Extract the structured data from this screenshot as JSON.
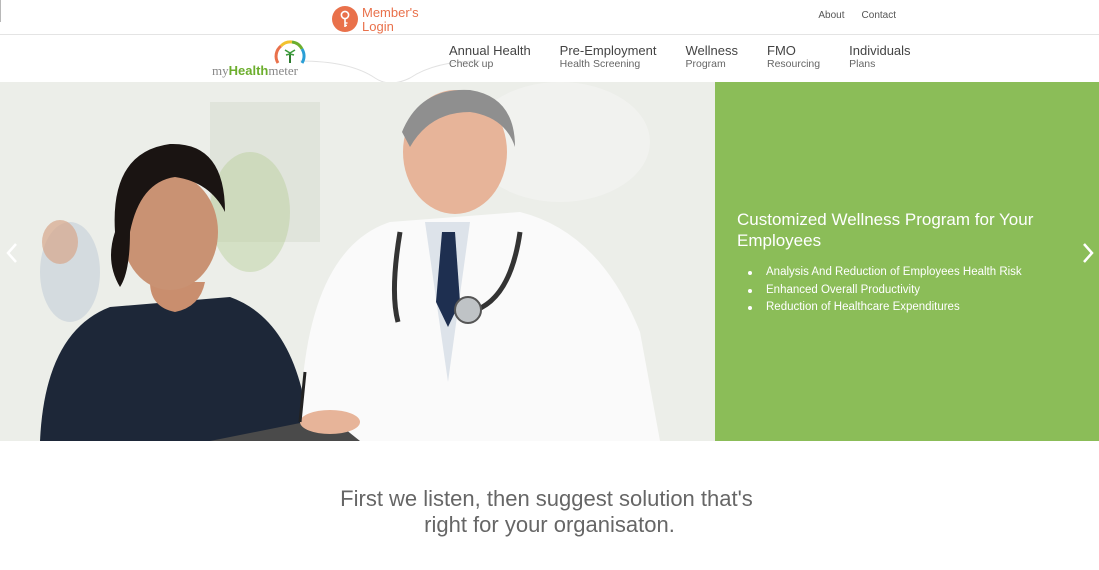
{
  "header": {
    "member_login": {
      "line1": "Member's",
      "line2": "Login"
    },
    "top_links": [
      {
        "label": "About"
      },
      {
        "label": "Contact"
      }
    ],
    "logo": {
      "my": "my",
      "health": "Health",
      "meter": "meter"
    }
  },
  "nav": {
    "items": [
      {
        "label": "Annual Health",
        "sub": "Check up"
      },
      {
        "label": "Pre-Employment",
        "sub": "Health Screening"
      },
      {
        "label": "Wellness",
        "sub": "Program"
      },
      {
        "label": "FMO",
        "sub": "Resourcing"
      },
      {
        "label": "Individuals",
        "sub": "Plans"
      }
    ]
  },
  "hero": {
    "title": "Customized Wellness Program for Your Employees",
    "bullets": [
      "Analysis And Reduction of Employees Health Risk",
      "Enhanced Overall Productivity",
      "Reduction of Healthcare Expenditures"
    ],
    "panel_color": "#8bbd58"
  },
  "tagline": {
    "line1": "First we listen, then suggest solution that's",
    "line2": "right for your organisaton."
  },
  "colors": {
    "accent": "#e9714b",
    "brand_green": "#6cae2d"
  }
}
